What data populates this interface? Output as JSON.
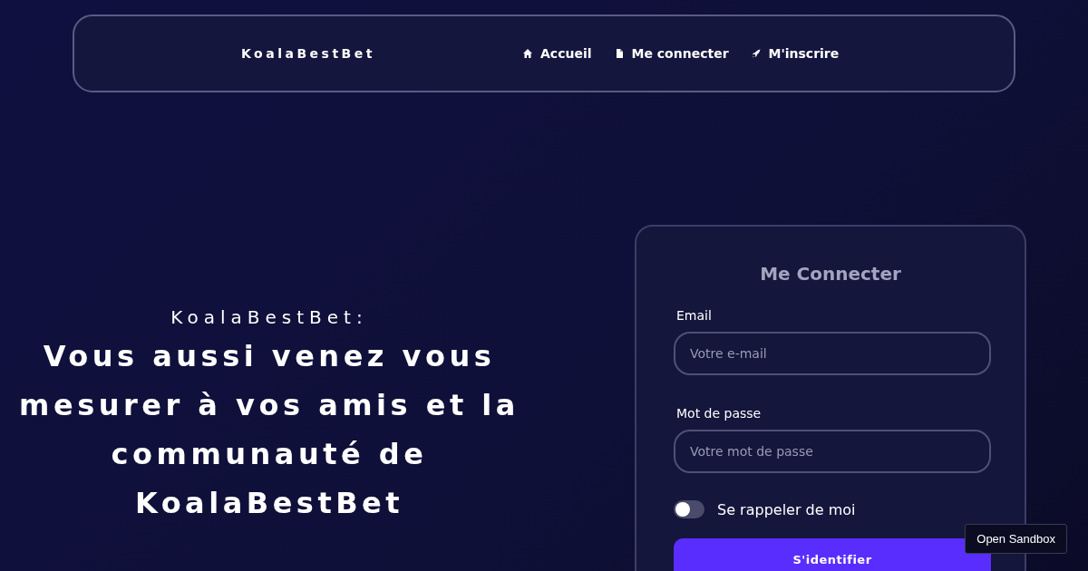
{
  "navbar": {
    "brand": "KoalaBestBet",
    "links": [
      {
        "label": "Accueil",
        "kind": "home"
      },
      {
        "label": "Me connecter",
        "kind": "document"
      },
      {
        "label": "M'inscrire",
        "kind": "rocket"
      }
    ]
  },
  "hero": {
    "kicker": "KoalaBestBet:",
    "headline": "Vous aussi venez vous mesurer à vos amis et la communauté de KoalaBestBet"
  },
  "login_card": {
    "title": "Me Connecter",
    "fields": [
      {
        "label": "Email",
        "placeholder": "Votre e-mail"
      },
      {
        "label": "Mot de passe",
        "placeholder": "Votre mot de passe"
      }
    ],
    "remember": {
      "label": "Se rappeler de moi",
      "on": false
    },
    "submit": "S'identifier"
  },
  "sandbox_button": "Open Sandbox"
}
